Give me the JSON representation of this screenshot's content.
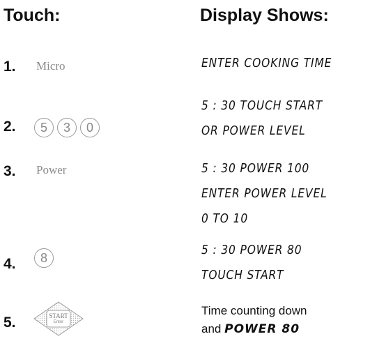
{
  "headers": {
    "touch": "Touch:",
    "display": "Display Shows:"
  },
  "steps": [
    {
      "number": "1.",
      "key": "Micro",
      "display": [
        "ENTER COOKING TIME"
      ]
    },
    {
      "number": "2.",
      "keys": [
        "5",
        "3",
        "0"
      ],
      "display": [
        "5 : 30 TOUCH START",
        "OR POWER LEVEL"
      ]
    },
    {
      "number": "3.",
      "key": "Power",
      "display": [
        "5 : 30 POWER 100",
        "ENTER POWER LEVEL",
        "0 TO 10"
      ]
    },
    {
      "number": "4.",
      "keys": [
        "8"
      ],
      "display": [
        "5 : 30 POWER 80",
        "TOUCH START"
      ]
    },
    {
      "number": "5.",
      "key_line1": "START",
      "key_line2": "Enter",
      "display_text": "Time counting down",
      "display_text2_prefix": "and",
      "display_text2_lcd": "POWER 80"
    }
  ],
  "icons": {
    "start_key": "start-enter-diamond-key-icon",
    "digit_key": "round-number-key-icon"
  }
}
